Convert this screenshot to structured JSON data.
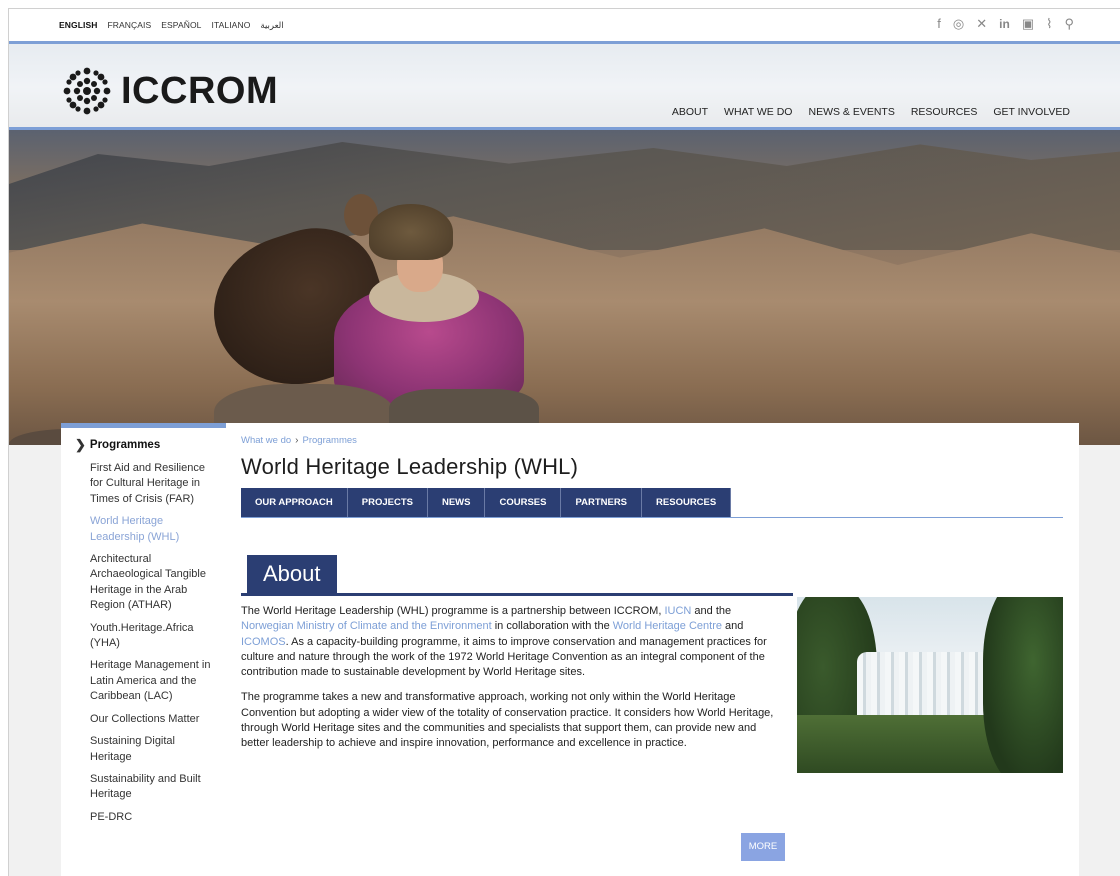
{
  "languages": [
    "ENGLISH",
    "FRANÇAIS",
    "ESPAÑOL",
    "ITALIANO",
    "العربية"
  ],
  "social_icons": [
    "facebook-icon",
    "instagram-icon",
    "x-icon",
    "linkedin-icon",
    "youtube-icon",
    "rss-icon",
    "search-icon"
  ],
  "brand": {
    "name": "ICCROM"
  },
  "nav": {
    "about": "ABOUT",
    "what_we_do": "WHAT WE DO",
    "news_events": "NEWS & EVENTS",
    "resources": "RESOURCES",
    "get_involved": "GET INVOLVED"
  },
  "sidebar": {
    "heading": "Programmes",
    "items": [
      "First Aid and Resilience for Cultural Heritage in Times of Crisis (FAR)",
      "World Heritage Leadership (WHL)",
      "Architectural Archaeological Tangible Heritage in the Arab Region (ATHAR)",
      "Youth.Heritage.Africa (YHA)",
      "Heritage Management in Latin America and the Caribbean (LAC)",
      "Our Collections Matter",
      "Sustaining Digital Heritage",
      "Sustainability and Built Heritage",
      "PE-DRC"
    ],
    "current_index": 1
  },
  "breadcrumb": {
    "first": "What we do",
    "second": "Programmes"
  },
  "page_title": "World Heritage Leadership (WHL)",
  "tabs": [
    "OUR APPROACH",
    "PROJECTS",
    "NEWS",
    "COURSES",
    "PARTNERS",
    "RESOURCES"
  ],
  "about": {
    "heading": "About",
    "p1": {
      "t1": "The World Heritage Leadership (WHL) programme is a partnership between ICCROM, ",
      "link1": "IUCN",
      "t2": " and the ",
      "link2": "Norwegian Ministry of Climate and the Environment",
      "t3": " in collaboration with the ",
      "link3": "World Heritage Centre",
      "t4": " and ",
      "link4": "ICOMOS",
      "t5": ". As a capacity-building programme, it aims to improve conservation and management practices for culture and nature through the work of the 1972 World Heritage Convention as an integral component of the contribution made to sustainable development by World Heritage sites."
    },
    "p2": "The programme takes a new and transformative approach, working not only within the World Heritage Convention but adopting a wider view of the totality of conservation practice. It considers how World Heritage, through World Heritage sites and the communities and specialists that support them, can provide new and better leadership to achieve and inspire innovation, performance and excellence in practice.",
    "more_label": "MORE"
  },
  "colors": {
    "accent": "#7d9fd6",
    "navy": "#2b3e73",
    "link": "#7d9fd6"
  }
}
